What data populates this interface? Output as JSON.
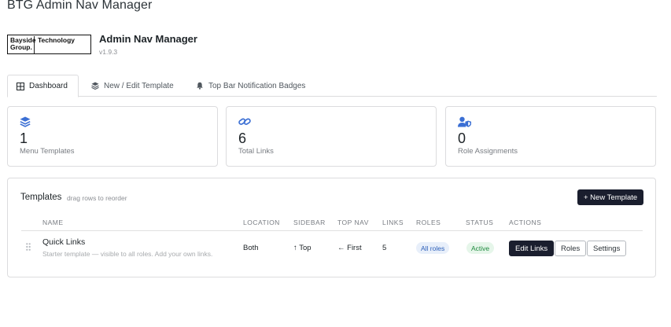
{
  "page": {
    "title": "BTG Admin Nav Manager"
  },
  "brand": {
    "logo_line1": "Bayside Technology",
    "logo_line2": "Group."
  },
  "app": {
    "title": "Admin Nav Manager",
    "version": "v1.9.3"
  },
  "tabs": [
    {
      "label": "Dashboard",
      "icon": "grid-icon",
      "active": true
    },
    {
      "label": "New / Edit Template",
      "icon": "layers-icon",
      "active": false
    },
    {
      "label": "Top Bar Notification Badges",
      "icon": "bell-icon",
      "active": false
    }
  ],
  "stats": [
    {
      "value": "1",
      "label": "Menu Templates",
      "icon": "layers-icon"
    },
    {
      "value": "6",
      "label": "Total Links",
      "icon": "link-icon"
    },
    {
      "value": "0",
      "label": "Role Assignments",
      "icon": "user-shield-icon"
    }
  ],
  "templates": {
    "title": "Templates",
    "hint": "drag rows to reorder",
    "new_button": "+ New Template",
    "columns": [
      "NAME",
      "LOCATION",
      "SIDEBAR",
      "TOP NAV",
      "LINKS",
      "ROLES",
      "STATUS",
      "ACTIONS"
    ],
    "rows": [
      {
        "name": "Quick Links",
        "description": "Starter template — visible to all roles. Add your own links.",
        "location": "Both",
        "sidebar": "↑ Top",
        "top_nav": "← First",
        "links": "5",
        "roles": "All roles",
        "status": "Active",
        "actions": [
          "Edit Links",
          "Roles",
          "Settings"
        ]
      }
    ]
  },
  "colors": {
    "accent": "#3b6fd4",
    "dark_button": "#1a1e2e",
    "status_active": "#1f8a3e",
    "roles_badge": "#2c5fb8"
  }
}
